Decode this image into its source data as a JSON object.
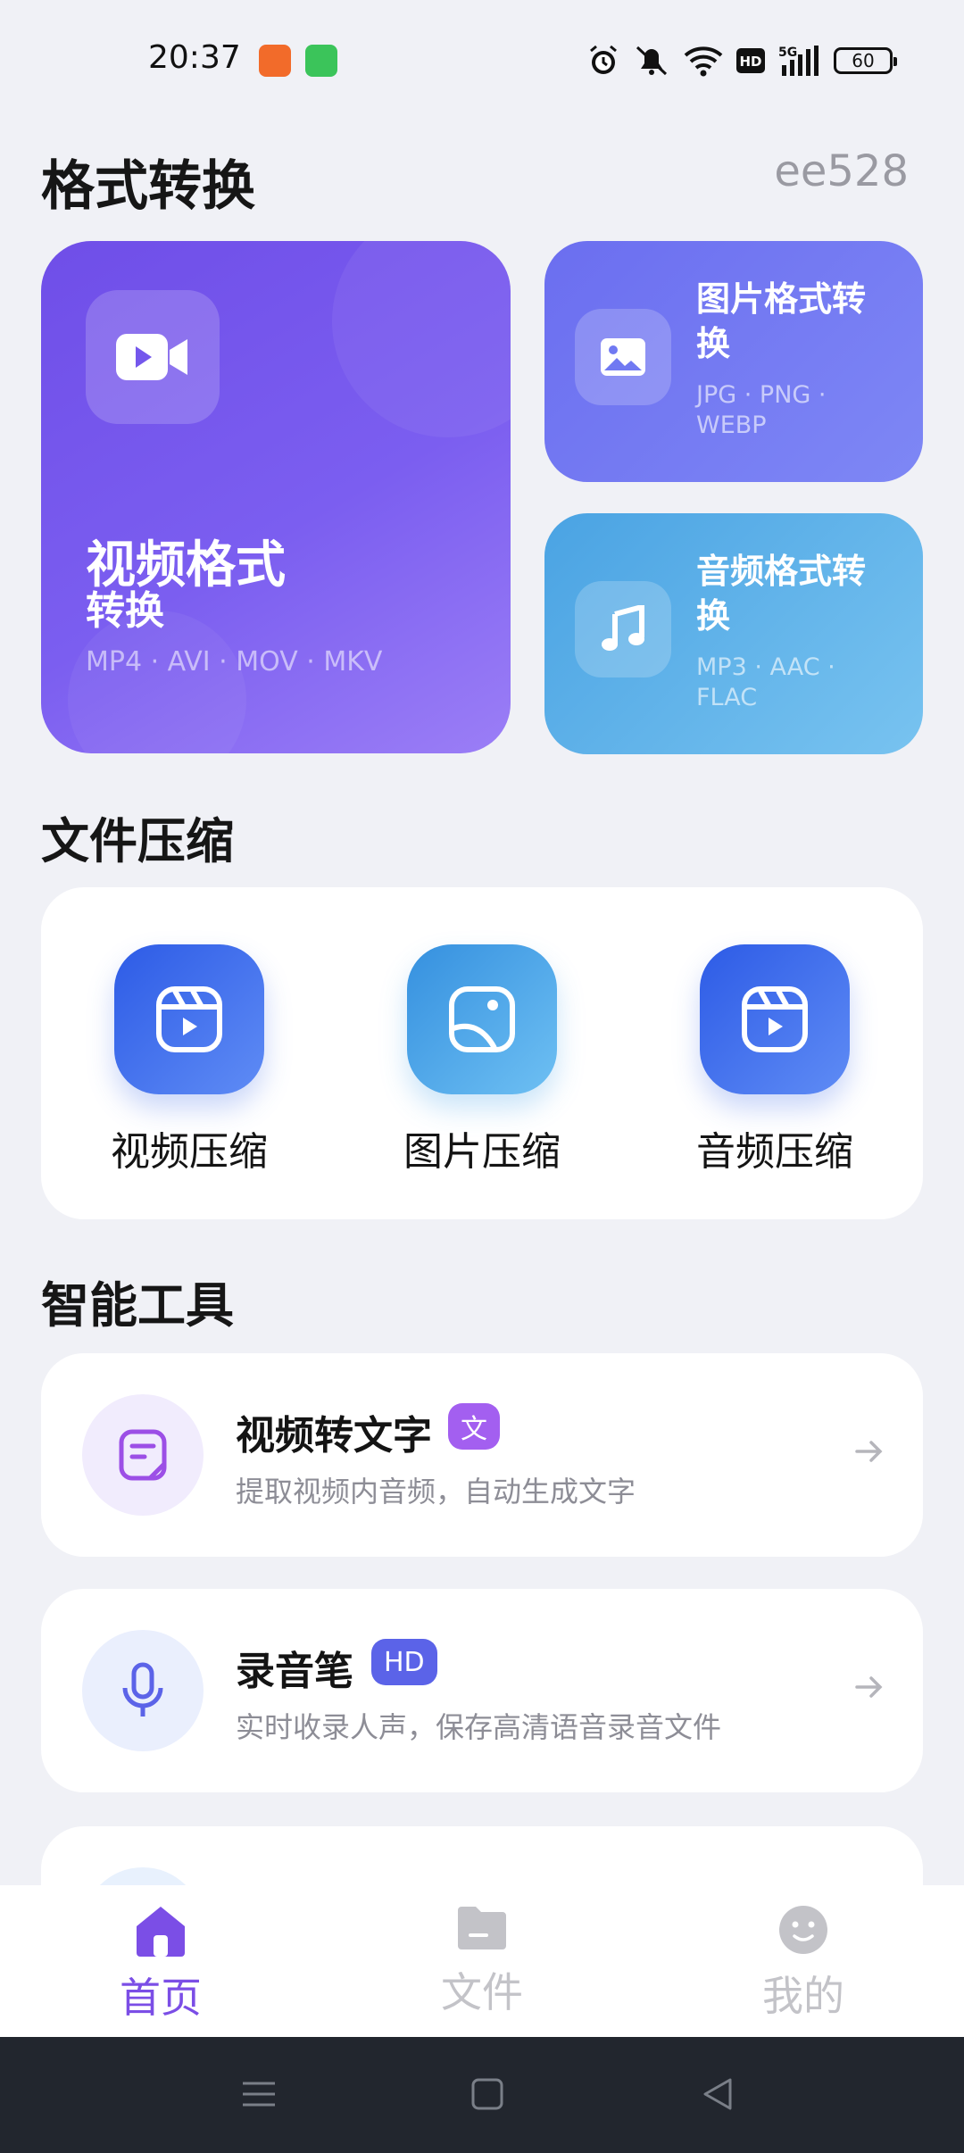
{
  "status_bar": {
    "time": "20:37",
    "network": "5G",
    "hd": "HD",
    "battery": "60",
    "icons": [
      "alarm-icon",
      "mute-icon",
      "wifi-icon",
      "hd-icon",
      "signal-5g-icon",
      "battery-icon"
    ]
  },
  "header": {
    "title": "格式转换",
    "user_id": "ee528"
  },
  "format_cards": {
    "video": {
      "title_line1": "视频格式",
      "title_line2": "转换",
      "formats": "MP4 · AVI · MOV · MKV",
      "icon": "video-camera-icon"
    },
    "image": {
      "title": "图片格式转换",
      "formats": "JPG · PNG · WEBP",
      "icon": "image-icon"
    },
    "audio": {
      "title": "音频格式转换",
      "formats": "MP3 · AAC · FLAC",
      "icon": "music-note-icon"
    }
  },
  "compress": {
    "title": "文件压缩",
    "items": [
      {
        "label": "视频压缩",
        "icon": "video-compress-icon"
      },
      {
        "label": "图片压缩",
        "icon": "image-compress-icon"
      },
      {
        "label": "音频压缩",
        "icon": "audio-compress-icon"
      }
    ]
  },
  "tools": {
    "title": "智能工具",
    "items": [
      {
        "title": "视频转文字",
        "badge": "文",
        "desc": "提取视频内音频，自动生成文字",
        "icon": "document-icon",
        "badge_color": "#a35ff0"
      },
      {
        "title": "录音笔",
        "badge": "HD",
        "desc": "实时收录人声，保存高清语音录音文件",
        "icon": "microphone-icon",
        "badge_color": "#5b63e8"
      }
    ]
  },
  "bottom_nav": {
    "items": [
      {
        "label": "首页",
        "icon": "home-icon",
        "active": true
      },
      {
        "label": "文件",
        "icon": "folder-icon",
        "active": false
      },
      {
        "label": "我的",
        "icon": "profile-face-icon",
        "active": false
      }
    ],
    "active_color": "#7b4ee6",
    "inactive_color": "#c3c3c8"
  },
  "colors": {
    "background": "#f0f1f6",
    "video_card": "#7457ec",
    "image_card": "#7079f2",
    "audio_card": "#5cb1ea"
  }
}
